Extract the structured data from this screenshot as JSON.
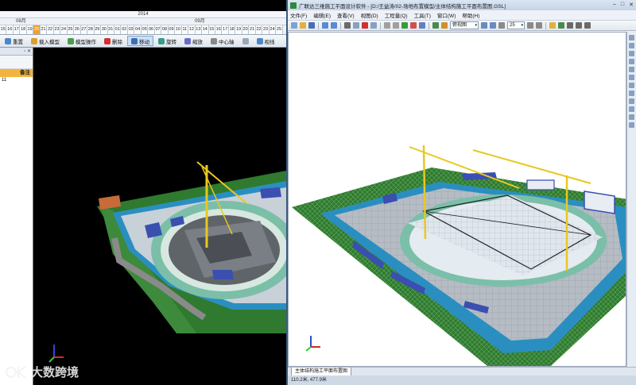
{
  "left": {
    "timeline": {
      "year": "2014",
      "month_a": "08月",
      "month_b": "09月",
      "days": [
        "15",
        "16",
        "17",
        "18",
        "19",
        "20",
        "21",
        "22",
        "23",
        "24",
        "25",
        "26",
        "27",
        "28",
        "29",
        "30",
        "31",
        "01",
        "02",
        "03",
        "04",
        "05",
        "06",
        "07",
        "08",
        "09",
        "10",
        "11",
        "12",
        "13",
        "14",
        "15",
        "16",
        "17",
        "18",
        "19",
        "20",
        "21",
        "22",
        "23",
        "24",
        "25"
      ],
      "active_day_index": 5
    },
    "toolbar": {
      "items": [
        {
          "label": "重置",
          "icon": "reset-icon",
          "color": "#4a88c8"
        },
        {
          "label": "载入模型",
          "icon": "load-model-icon",
          "color": "#d9a030"
        },
        {
          "label": "模型操作",
          "icon": "model-operate-icon",
          "color": "#4b9c4b"
        },
        {
          "label": "删除",
          "icon": "delete-icon",
          "color": "#d23030"
        },
        {
          "label": "移动",
          "icon": "move-icon",
          "color": "#3d6fb0",
          "pressed": true
        },
        {
          "label": "旋转",
          "icon": "rotate-icon",
          "color": "#3a9a8a"
        },
        {
          "label": "缩放",
          "icon": "scale-icon",
          "color": "#6a6acb"
        },
        {
          "label": "中心轴",
          "icon": "center-axis-icon",
          "color": "#888888"
        },
        {
          "label": "",
          "icon": "hide-icon",
          "color": "#9aa7b8"
        },
        {
          "label": "视线",
          "icon": "view-icon",
          "color": "#4a88c8"
        }
      ]
    },
    "panel": {
      "column_header": "备注",
      "row_value": "11"
    }
  },
  "right": {
    "title": "广联达三维施工平面设计软件 - [D:/王益涛/02-场地布置模型/主体结构施工平面布置图.GSL]",
    "menu": [
      "文件(F)",
      "编辑(E)",
      "查看(V)",
      "视图(D)",
      "工程量(Q)",
      "工具(T)",
      "窗口(W)",
      "帮助(H)"
    ],
    "toolbar": {
      "view_select": "俯视图",
      "zoom_select": "25"
    },
    "tab_label": "主体结构施工平面布置图",
    "status": "110.2米, 477.9米"
  },
  "watermark": {
    "text": "大数跨境"
  },
  "colors": {
    "grass": "#2f7a2f",
    "water": "#2a8fc0",
    "crane": "#e8c820",
    "building_blue": "#3a4fb0",
    "concrete": "#8a8f96",
    "timeline_active": "#f0a030",
    "panel_header": "#f2b43d"
  }
}
